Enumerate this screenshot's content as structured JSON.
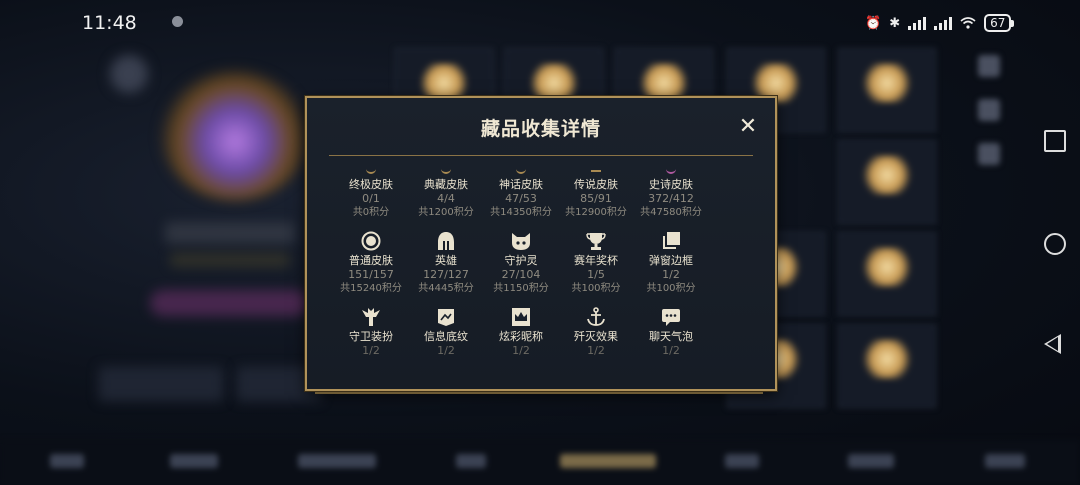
{
  "status_bar": {
    "time": "11:48",
    "battery": "67"
  },
  "modal": {
    "title": "藏品收集详情",
    "close_label": "✕",
    "rows": [
      [
        {
          "icon": "ultimate-skin-icon",
          "label": "终极皮肤",
          "count": "0/1",
          "points": "共0积分"
        },
        {
          "icon": "legacy-skin-icon",
          "label": "典藏皮肤",
          "count": "4/4",
          "points": "共1200积分"
        },
        {
          "icon": "mythic-skin-icon",
          "label": "神话皮肤",
          "count": "47/53",
          "points": "共14350积分"
        },
        {
          "icon": "legendary-skin-icon",
          "label": "传说皮肤",
          "count": "85/91",
          "points": "共12900积分"
        },
        {
          "icon": "epic-skin-icon",
          "label": "史诗皮肤",
          "count": "372/412",
          "points": "共47580积分"
        }
      ],
      [
        {
          "icon": "standard-skin-icon",
          "label": "普通皮肤",
          "count": "151/157",
          "points": "共15240积分"
        },
        {
          "icon": "helmet-icon",
          "label": "英雄",
          "count": "127/127",
          "points": "共4445积分"
        },
        {
          "icon": "ward-spirit-icon",
          "label": "守护灵",
          "count": "27/104",
          "points": "共1150积分"
        },
        {
          "icon": "trophy-icon",
          "label": "赛年奖杯",
          "count": "1/5",
          "points": "共100积分"
        },
        {
          "icon": "frame-icon",
          "label": "弹窗边框",
          "count": "1/2",
          "points": "共100积分"
        }
      ],
      [
        {
          "icon": "ward-skin-icon",
          "label": "守卫装扮",
          "count": "1/2"
        },
        {
          "icon": "banner-icon",
          "label": "信息底纹",
          "count": "1/2"
        },
        {
          "icon": "crown-icon",
          "label": "炫彩昵称",
          "count": "1/2"
        },
        {
          "icon": "anchor-icon",
          "label": "歼灭效果",
          "count": "1/2"
        },
        {
          "icon": "chat-bubble-icon",
          "label": "聊天气泡",
          "count": "1/2"
        }
      ]
    ]
  },
  "colors": {
    "accent_gold": "#b0925a",
    "modal_bg": "#1a212b",
    "text_primary": "#e9e2cf",
    "text_muted": "#8f8b80"
  }
}
